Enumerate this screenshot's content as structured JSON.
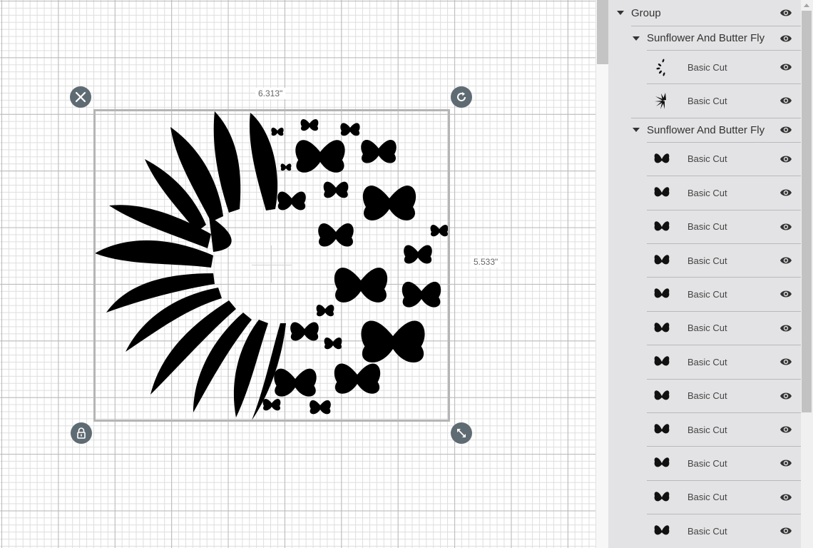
{
  "canvas": {
    "width_label": "6.313\"",
    "height_label": "5.533\"",
    "handles": {
      "delete": "close-icon",
      "rotate": "rotate-icon",
      "lock": "lock-icon",
      "resize": "resize-icon"
    }
  },
  "layers": {
    "group": {
      "label": "Group",
      "expanded": true,
      "visible": true
    },
    "subgroups": [
      {
        "label": "Sunflower And Butter Fly",
        "expanded": true,
        "visible": true,
        "items": [
          {
            "label": "Basic Cut",
            "thumb": "sunflower-seeds",
            "visible": true
          },
          {
            "label": "Basic Cut",
            "thumb": "sunflower-petals",
            "visible": true
          }
        ]
      },
      {
        "label": "Sunflower And Butter Fly",
        "expanded": true,
        "visible": true,
        "items": [
          {
            "label": "Basic Cut",
            "thumb": "butterfly",
            "visible": true
          },
          {
            "label": "Basic Cut",
            "thumb": "butterfly",
            "visible": true
          },
          {
            "label": "Basic Cut",
            "thumb": "butterfly",
            "visible": true
          },
          {
            "label": "Basic Cut",
            "thumb": "butterfly",
            "visible": true
          },
          {
            "label": "Basic Cut",
            "thumb": "butterfly",
            "visible": true
          },
          {
            "label": "Basic Cut",
            "thumb": "butterfly",
            "visible": true
          },
          {
            "label": "Basic Cut",
            "thumb": "butterfly",
            "visible": true
          },
          {
            "label": "Basic Cut",
            "thumb": "butterfly",
            "visible": true
          },
          {
            "label": "Basic Cut",
            "thumb": "butterfly",
            "visible": true
          },
          {
            "label": "Basic Cut",
            "thumb": "butterfly",
            "visible": true
          },
          {
            "label": "Basic Cut",
            "thumb": "butterfly",
            "visible": true
          },
          {
            "label": "Basic Cut",
            "thumb": "butterfly",
            "visible": true
          }
        ]
      }
    ]
  }
}
